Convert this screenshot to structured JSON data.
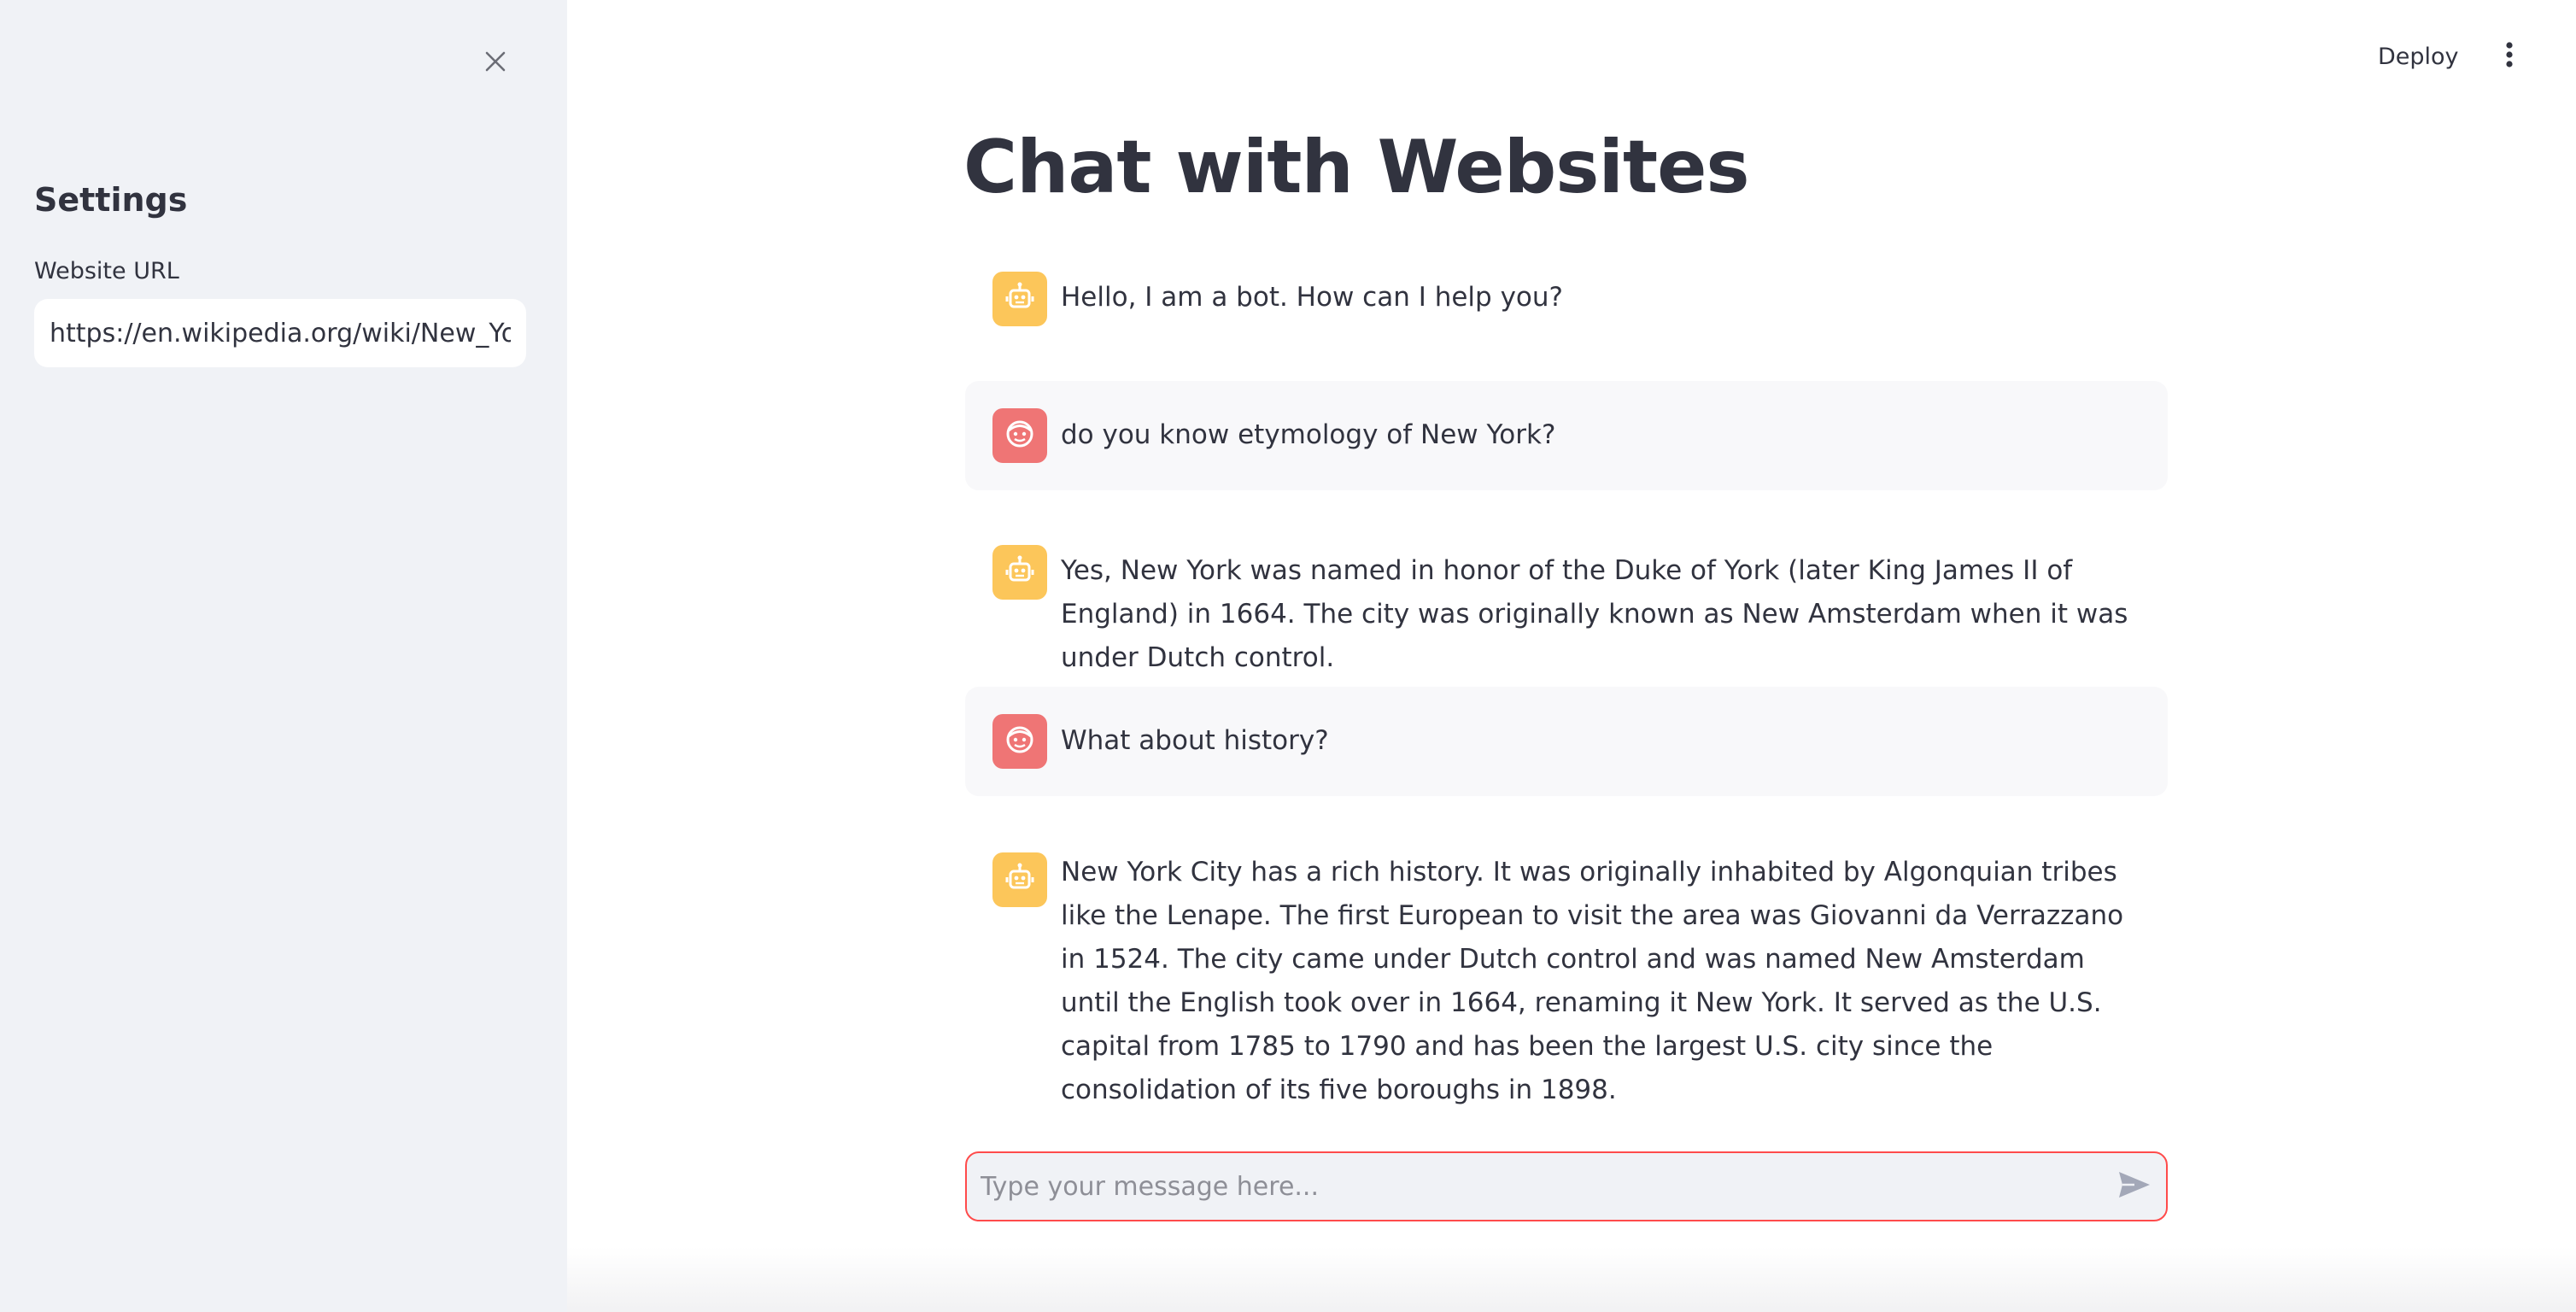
{
  "sidebar": {
    "heading": "Settings",
    "url_label": "Website URL",
    "url_value": "https://en.wikipedia.org/wiki/New_York_City"
  },
  "header": {
    "deploy_label": "Deploy"
  },
  "main": {
    "title": "Chat with Websites",
    "messages": [
      {
        "role": "bot",
        "text": "Hello, I am a bot. How can I help you?"
      },
      {
        "role": "user",
        "text": "do you know etymology of New York?"
      },
      {
        "role": "bot",
        "text": "Yes, New York was named in honor of the Duke of York (later King James II of England) in 1664. The city was originally known as New Amsterdam when it was under Dutch control."
      },
      {
        "role": "user",
        "text": "What about history?"
      },
      {
        "role": "bot",
        "text": "New York City has a rich history. It was originally inhabited by Algonquian tribes like the Lenape. The first European to visit the area was Giovanni da Verrazzano in 1524. The city came under Dutch control and was named New Amsterdam until the English took over in 1664, renaming it New York. It served as the U.S. capital from 1785 to 1790 and has been the largest U.S. city since the consolidation of its five boroughs in 1898."
      }
    ]
  },
  "chat_input": {
    "placeholder": "Type your message here..."
  },
  "icons": {
    "close": "close-icon",
    "menu": "more-vertical-icon",
    "bot_avatar": "robot-icon",
    "user_avatar": "face-icon",
    "send": "send-icon"
  },
  "colors": {
    "sidebar_bg": "#f0f2f6",
    "bot_avatar": "#fcc65a",
    "user_avatar": "#ef7575",
    "input_border": "#ff4b4b",
    "text": "#31333f"
  }
}
